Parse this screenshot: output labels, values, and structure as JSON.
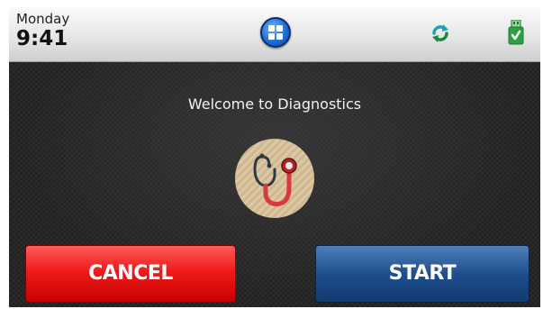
{
  "status_bar": {
    "day": "Monday",
    "time": "9:41",
    "home_icon": "home-grid-icon",
    "sync_icon": "sync-icon",
    "usb_icon": "usb-ok-icon"
  },
  "main": {
    "welcome_text": "Welcome to Diagnostics",
    "center_icon": "stethoscope-icon"
  },
  "buttons": {
    "cancel_label": "CANCEL",
    "start_label": "START"
  },
  "colors": {
    "cancel": "#ee1c1c",
    "start": "#1d4f8e",
    "home": "#1e6fd6",
    "sync": "#1aa0b8",
    "usb": "#2ea043",
    "stethoscope_bg": "#d9c4a0",
    "stethoscope_tube": "#d63b3b"
  }
}
